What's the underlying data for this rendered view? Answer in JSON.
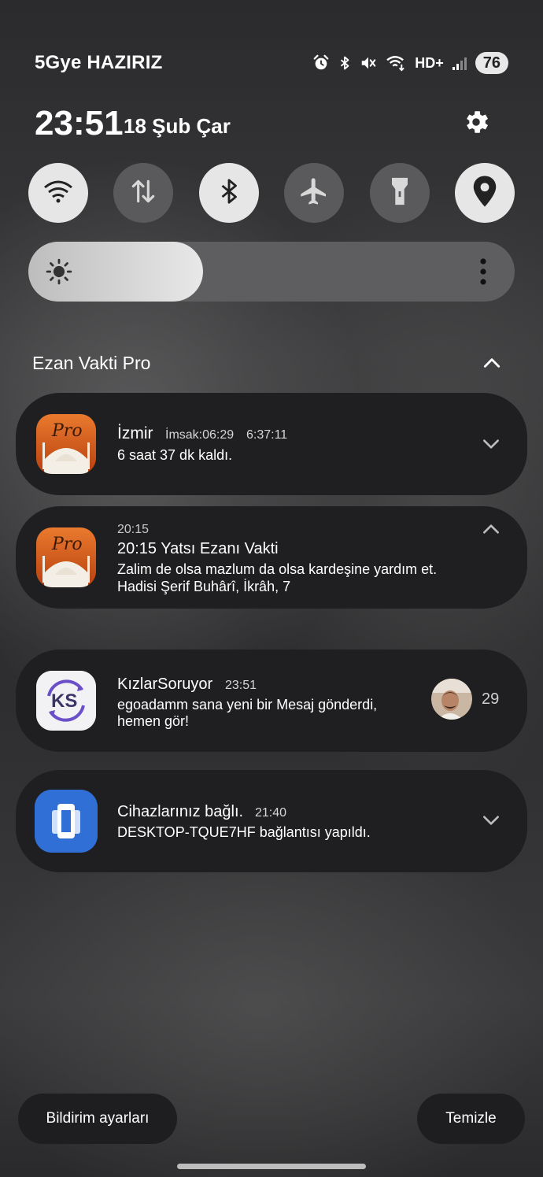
{
  "status_bar": {
    "carrier": "5Gye HAZIRIZ",
    "network_label": "HD+",
    "battery": "76",
    "icons": [
      "alarm-icon",
      "bluetooth-icon",
      "mute-icon",
      "wifi-icon",
      "signal-icon"
    ]
  },
  "header": {
    "time": "23:51",
    "date": "18 Şub Çar"
  },
  "quick_toggles": [
    {
      "name": "wifi",
      "state": "on"
    },
    {
      "name": "mobile-data",
      "state": "off"
    },
    {
      "name": "bluetooth",
      "state": "on"
    },
    {
      "name": "airplane-mode",
      "state": "off"
    },
    {
      "name": "flashlight",
      "state": "off"
    },
    {
      "name": "location",
      "state": "on"
    }
  ],
  "brightness": {
    "level": 0.36
  },
  "group": {
    "title": "Ezan Vakti Pro"
  },
  "notifications": [
    {
      "app_icon_text": "Pro",
      "title": "İzmir",
      "meta1": "İmsak:06:29",
      "meta2": "6:37:11",
      "body": "6 saat 37 dk kaldı."
    },
    {
      "app_icon_text": "Pro",
      "time": "20:15",
      "title": "20:15 Yatsı Ezanı Vakti",
      "body_line1": "Zalim de olsa mazlum da olsa kardeşine yardım et.",
      "body_line2": "Hadisi Şerif Buhârî, İkrâh, 7"
    },
    {
      "app_icon_text": "KS",
      "title": "KızlarSoruyor",
      "time": "23:51",
      "body_line1": "egoadamm sana yeni bir Mesaj gönderdi,",
      "body_line2": "hemen gör!",
      "count": "29"
    },
    {
      "title": "Cihazlarınız bağlı.",
      "time": "21:40",
      "body": "DESKTOP-TQUE7HF bağlantısı yapıldı."
    }
  ],
  "footer": {
    "settings_label": "Bildirim ayarları",
    "clear_label": "Temizle"
  },
  "colors": {
    "card_bg": "#1f1f21",
    "toggle_on": "#e6e6e6",
    "toggle_off": "#5a5a5c",
    "ezan_orange": "#d9571c",
    "ks_purple": "#6a4fc8",
    "link_blue": "#2f6fd6"
  }
}
